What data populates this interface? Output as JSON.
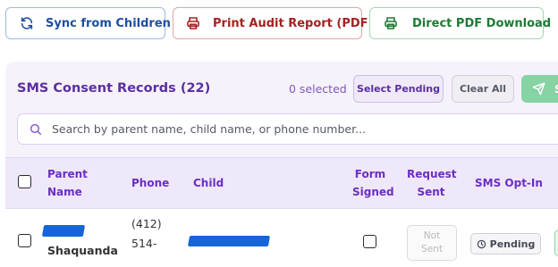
{
  "toolbar": {
    "sync_label": "Sync from Children",
    "audit_label": "Print Audit Report (PDF)",
    "pdf_label": "Direct PDF Download"
  },
  "panel": {
    "title": "SMS Consent Records (22)",
    "selected_count": "0 selected",
    "select_pending_label": "Select Pending",
    "clear_all_label": "Clear All",
    "send_label": "S"
  },
  "search": {
    "placeholder": "Search by parent name, child name, or phone number..."
  },
  "table": {
    "columns": {
      "parent_name_1": "Parent",
      "parent_name_2": "Name",
      "phone": "Phone",
      "child": "Child",
      "form_signed_1": "Form",
      "form_signed_2": "Signed",
      "request_sent_1": "Request",
      "request_sent_2": "Sent",
      "sms_opt_in": "SMS Opt-In"
    },
    "rows": [
      {
        "parent_name_visible": "Shaquanda",
        "phone_line1": "(412)",
        "phone_line2": "514-",
        "request_sent_line1": "Not",
        "request_sent_line2": "Sent",
        "sms_opt_in": "Pending"
      }
    ]
  },
  "colors": {
    "sync_accent": "#1e4fa0",
    "audit_accent": "#a32222",
    "pdf_accent": "#1f7a35",
    "panel_bg": "#f6f2fc",
    "header_text": "#6a2fc4",
    "send_bg": "#86d3a4",
    "redaction": "#1565d8"
  },
  "icons": {
    "sync": "refresh-icon",
    "audit": "printer-icon",
    "pdf": "printer-icon",
    "send": "send-icon",
    "search": "search-icon",
    "pending": "clock-icon"
  }
}
